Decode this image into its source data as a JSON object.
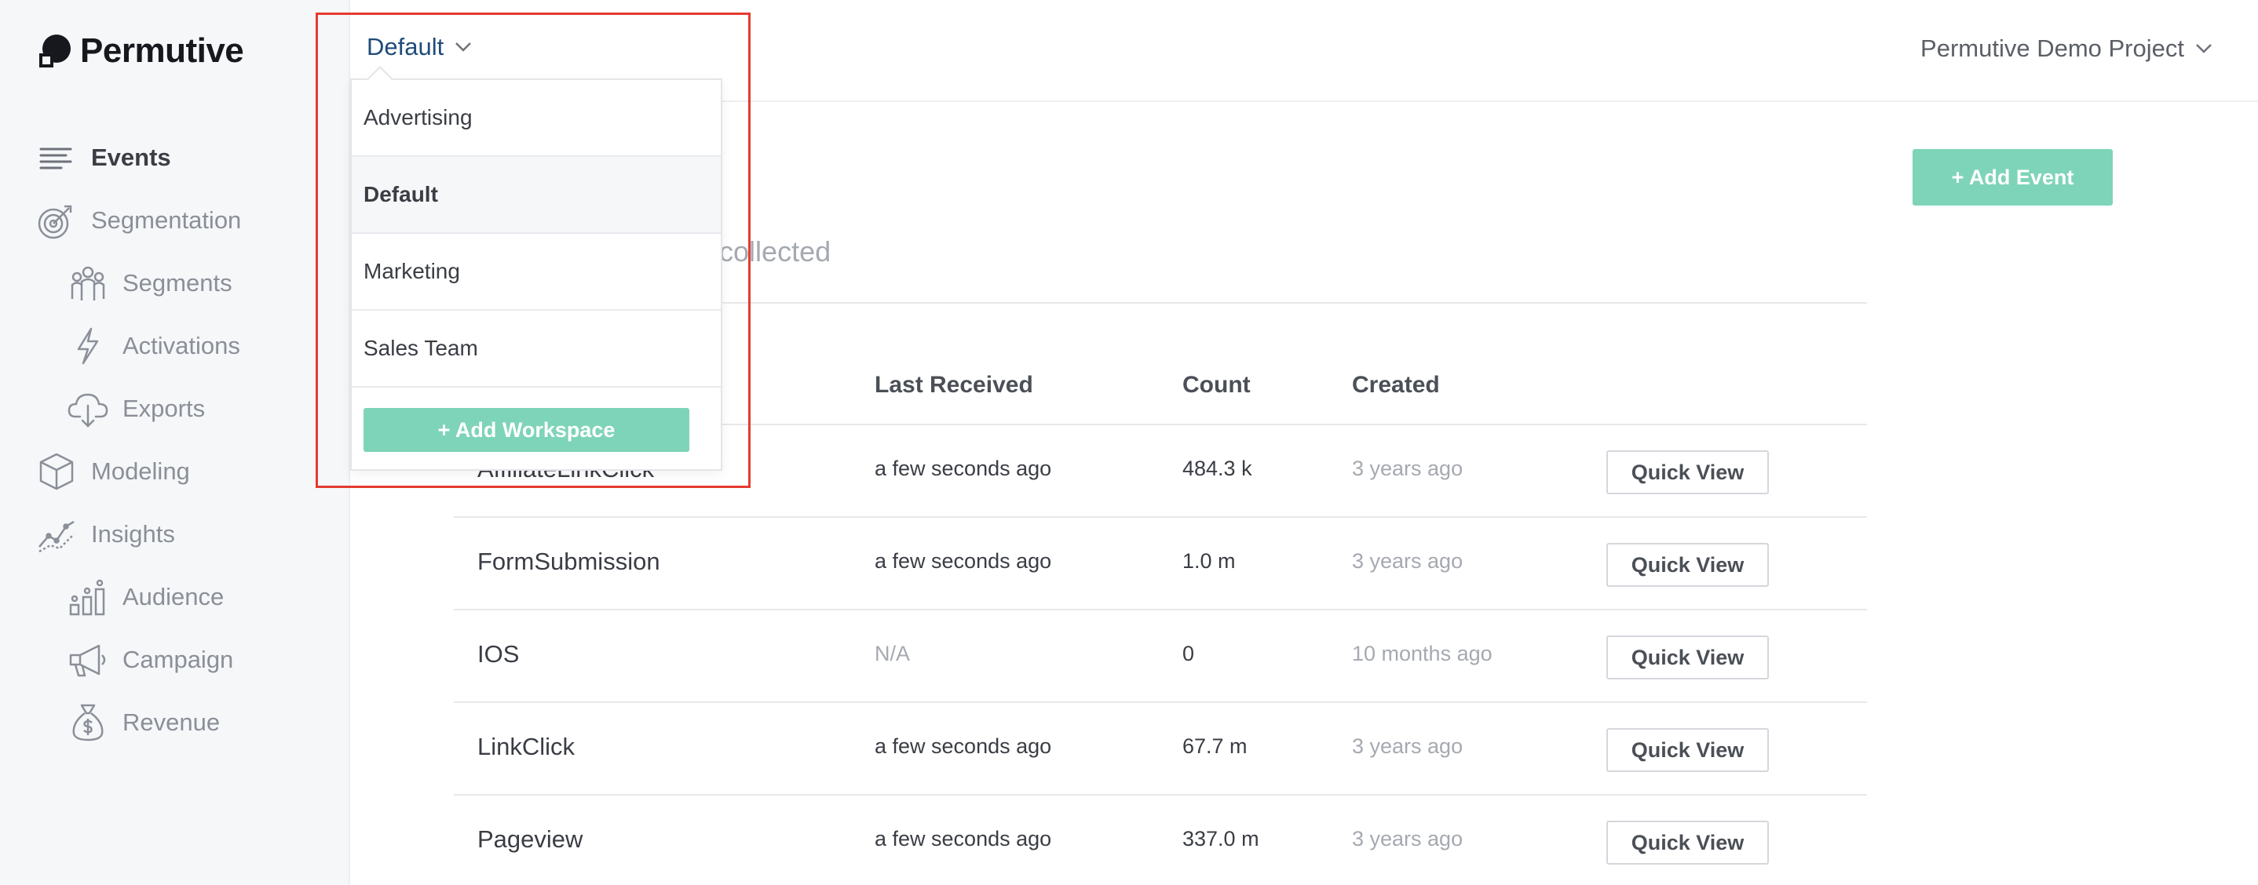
{
  "brand": {
    "name": "Permutive"
  },
  "workspace": {
    "current": "Default",
    "options": [
      "Advertising",
      "Default",
      "Marketing",
      "Sales Team"
    ],
    "add_label": "+ Add Workspace"
  },
  "project": {
    "name": "Permutive Demo Project"
  },
  "sidebar": {
    "items": [
      {
        "label": "Events",
        "icon": "lines-icon",
        "active": true
      },
      {
        "label": "Segmentation",
        "icon": "target-icon"
      },
      {
        "label": "Segments",
        "icon": "people-icon"
      },
      {
        "label": "Activations",
        "icon": "bolt-icon"
      },
      {
        "label": "Exports",
        "icon": "cloud-download-icon"
      },
      {
        "label": "Modeling",
        "icon": "cube-icon"
      },
      {
        "label": "Insights",
        "icon": "line-chart-icon"
      },
      {
        "label": "Audience",
        "icon": "bar-people-icon"
      },
      {
        "label": "Campaign",
        "icon": "megaphone-icon"
      },
      {
        "label": "Revenue",
        "icon": "money-bag-icon"
      }
    ]
  },
  "main": {
    "subtitle_visible": "ve collected",
    "add_event_label": "+ Add Event",
    "columns": [
      "Last Received",
      "Count",
      "Created"
    ],
    "quick_view_label": "Quick View",
    "rows": [
      {
        "name": "AffiliateLinkClick",
        "last_received": "a few seconds ago",
        "count": "484.3 k",
        "created": "3 years ago"
      },
      {
        "name": "FormSubmission",
        "last_received": "a few seconds ago",
        "count": "1.0 m",
        "created": "3 years ago"
      },
      {
        "name": "IOS",
        "last_received": "N/A",
        "count": "0",
        "created": "10 months ago"
      },
      {
        "name": "LinkClick",
        "last_received": "a few seconds ago",
        "count": "67.7 m",
        "created": "3 years ago"
      },
      {
        "name": "Pageview",
        "last_received": "a few seconds ago",
        "count": "337.0 m",
        "created": "3 years ago"
      }
    ]
  },
  "colors": {
    "accent": "#7ed4b8",
    "workspace_text": "#1f4b7a",
    "highlight": "#e53b30"
  }
}
